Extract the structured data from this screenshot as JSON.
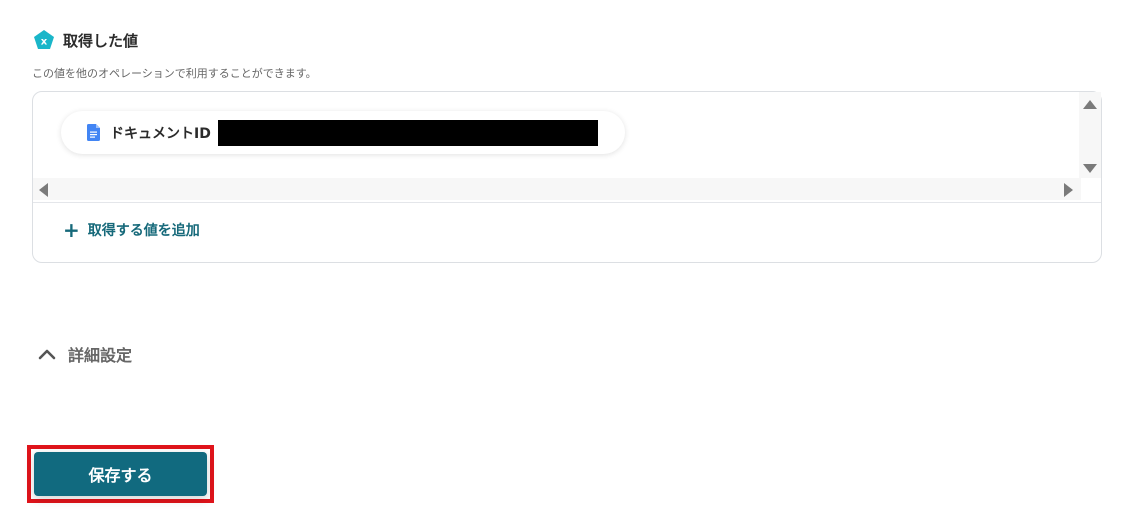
{
  "section": {
    "title": "取得した値",
    "description": "この値を他のオペレーションで利用することができます。",
    "badge_icon": "yoom-badge-icon",
    "accent_color": "#1ab6c9"
  },
  "values": {
    "items": [
      {
        "label": "ドキュメントID",
        "icon": "google-docs-icon",
        "value_redacted": true
      }
    ],
    "add_label": "取得する値を追加"
  },
  "advanced": {
    "label": "詳細設定",
    "expanded": true
  },
  "actions": {
    "save_label": "保存する",
    "save_color": "#116a7f",
    "highlight_color": "#e0141b"
  }
}
